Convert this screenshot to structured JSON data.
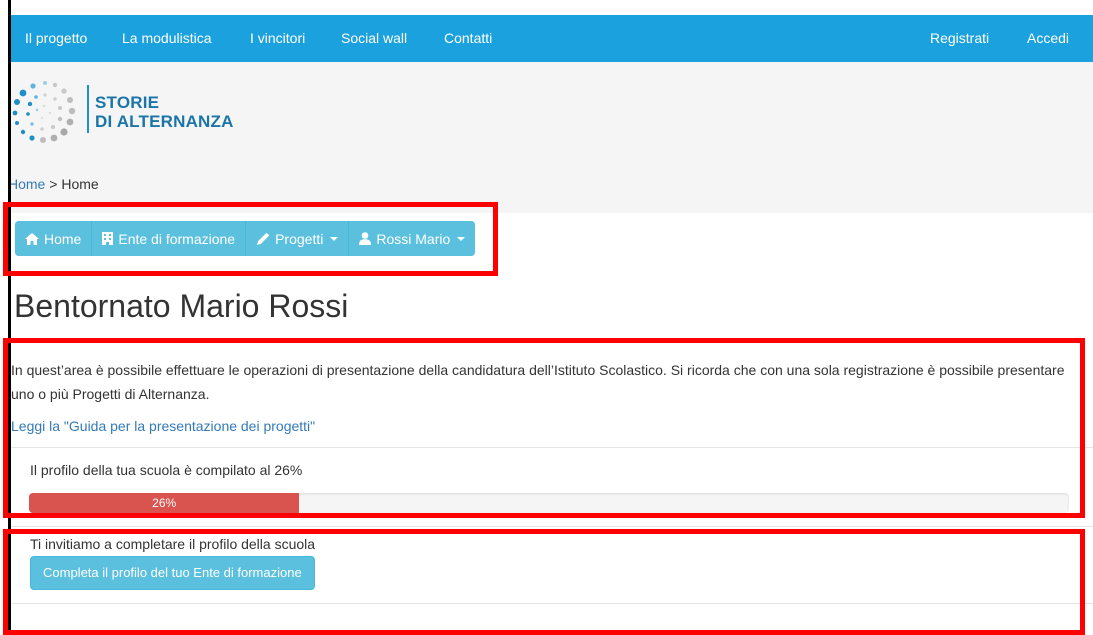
{
  "topnav": {
    "left_items": [
      "Il progetto",
      "La modulistica",
      "I vincitori",
      "Social wall",
      "Contatti"
    ],
    "right_items": [
      "Registrati",
      "Accedi"
    ]
  },
  "logo": {
    "line1": "STORIE",
    "line2": "DI ALTERNANZA"
  },
  "breadcrumb": {
    "home_link": "Home",
    "separator": ">",
    "current": "Home"
  },
  "navgroup": {
    "home": "Home",
    "ente": "Ente di formazione",
    "progetti": "Progetti",
    "user": "Rossi Mario"
  },
  "main": {
    "title": "Bentornato Mario Rossi",
    "intro": "In quest’area è possibile effettuare le operazioni di presentazione della candidatura dell’Istituto Scolastico. Si ricorda che con una sola registrazione è possibile presentare uno o più Progetti di Alternanza.",
    "guide_link": "Leggi la \"Guida per la presentazione dei progetti\"",
    "progress_label": "Il profilo della tua scuola è compilato al 26%",
    "progress_value": 0.26,
    "progress_text": "26%",
    "invite_text": "Ti invitiamo a completare il profilo della scuola",
    "complete_button": "Completa il profilo del tuo Ente di formazione"
  },
  "colors": {
    "navbar": "#1ba2de",
    "button": "#5bc0de",
    "progress": "#d9534f",
    "highlight": "#ff0000",
    "link": "#337ab7"
  }
}
